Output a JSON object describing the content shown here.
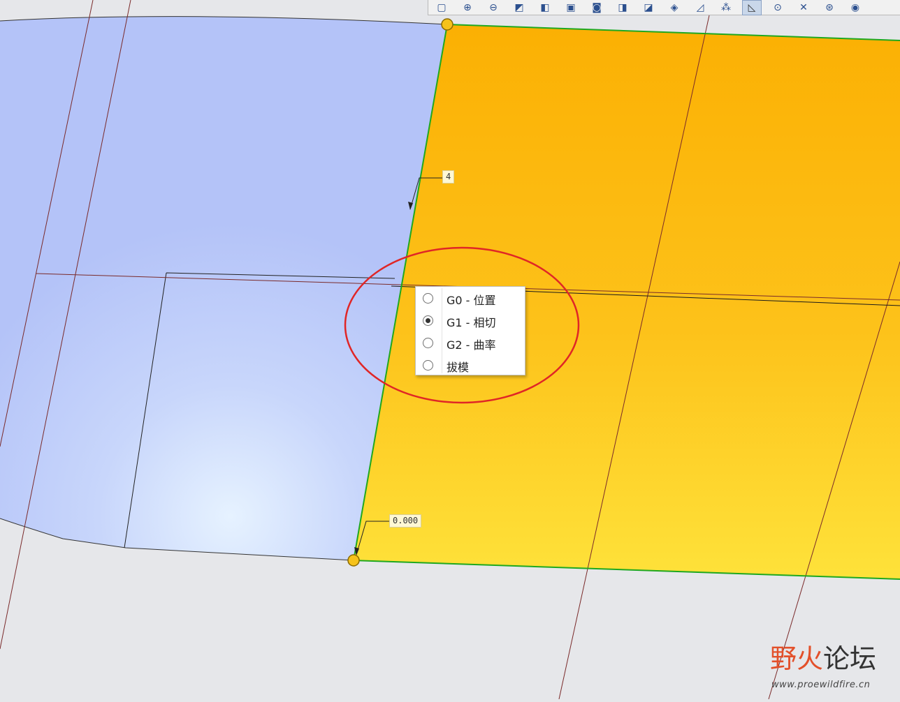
{
  "toolbar": {
    "buttons": [
      {
        "icon": "zoom-fit-icon",
        "glyph": "▢"
      },
      {
        "icon": "zoom-in-icon",
        "glyph": "⊕"
      },
      {
        "icon": "zoom-out-icon",
        "glyph": "⊖"
      },
      {
        "icon": "repaint-icon",
        "glyph": "◩"
      },
      {
        "icon": "display-style-icon",
        "glyph": "◧"
      },
      {
        "icon": "view-manager-icon",
        "glyph": "▣"
      },
      {
        "icon": "camera-icon",
        "glyph": "◙"
      },
      {
        "icon": "saved-orientations-icon",
        "glyph": "◨"
      },
      {
        "icon": "spin-center-icon",
        "glyph": "◪"
      },
      {
        "icon": "view-normal-icon",
        "glyph": "◈"
      },
      {
        "icon": "annotation-display-icon",
        "glyph": "◿"
      },
      {
        "icon": "point-display-icon",
        "glyph": "⁂"
      },
      {
        "icon": "plane-display-icon",
        "glyph": "◺"
      },
      {
        "icon": "axis-display-icon",
        "glyph": "⊙"
      },
      {
        "icon": "csys-display-icon",
        "glyph": "✕"
      },
      {
        "icon": "point-tag-display-icon",
        "glyph": "⊛"
      },
      {
        "icon": "spin-center-display-icon",
        "glyph": "◉"
      }
    ],
    "active_index": 12
  },
  "continuity_menu": {
    "items": [
      {
        "label": "G0 - 位置",
        "checked": false
      },
      {
        "label": "G1 - 相切",
        "checked": true
      },
      {
        "label": "G2 - 曲率",
        "checked": false
      },
      {
        "label": "拔模",
        "checked": false
      }
    ]
  },
  "dimensions": {
    "top_value": "4",
    "bottom_value": "0.000"
  },
  "watermark": {
    "brand_part1": "野火",
    "brand_part2": "论坛",
    "url": "www.proewildfire.cn"
  },
  "colors": {
    "background": "#e6e7ea",
    "blue_surface": "#b4c3f8",
    "orange_surface_top": "#fbb003",
    "orange_surface_bottom": "#fee23a",
    "boundary_green": "#1fa81f",
    "handle_fill": "#f6c21a",
    "highlight_circle": "#e02626",
    "datum_line": "#7a2a2a"
  }
}
